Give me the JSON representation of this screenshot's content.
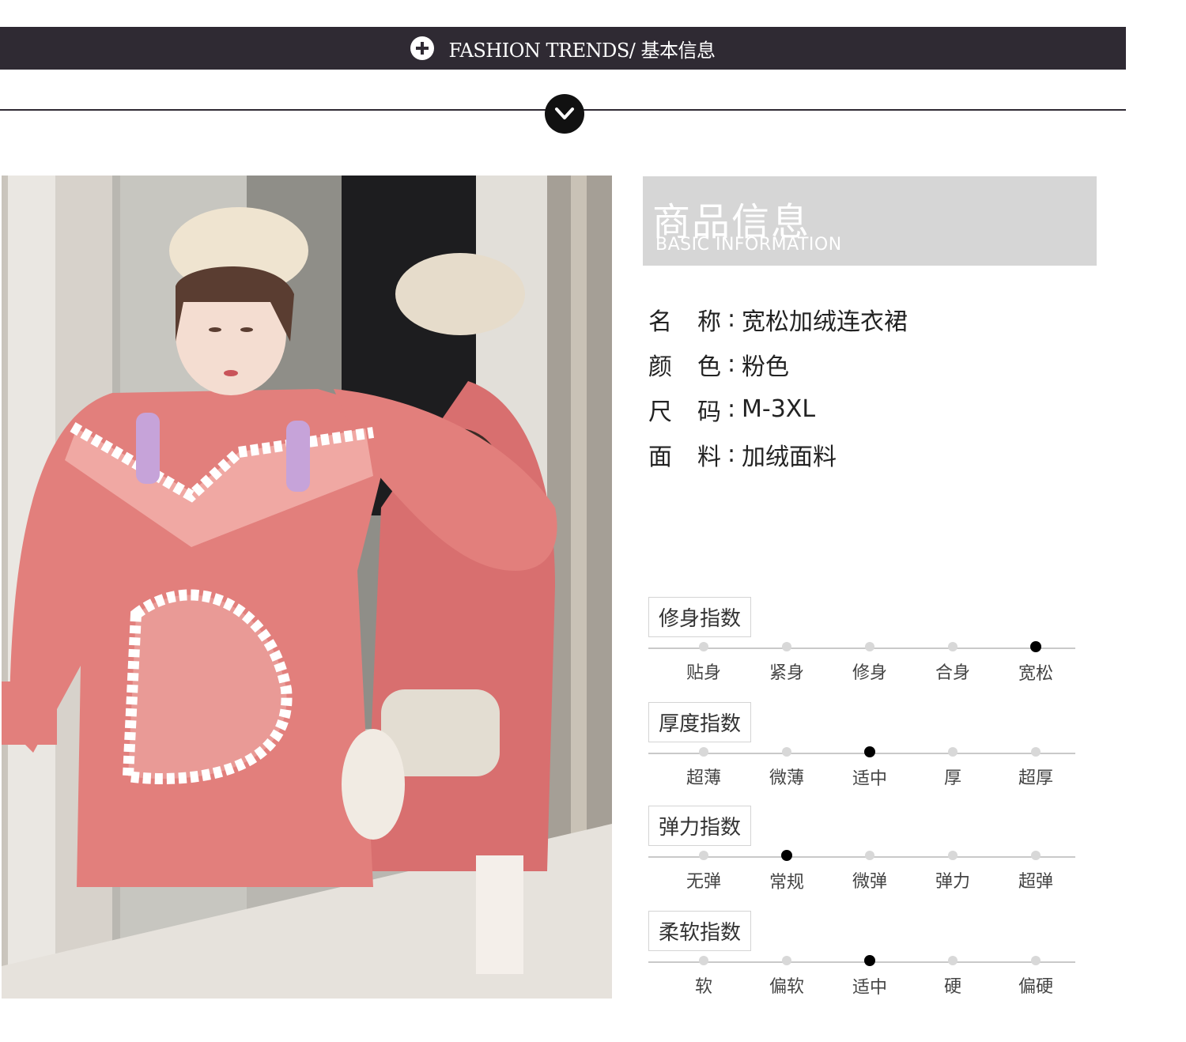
{
  "header": {
    "banner_text": "FASHION TRENDS/  基本信息"
  },
  "info_box": {
    "title_zh": "商品信息",
    "title_en": "BASIC  INFORMATION"
  },
  "attributes": [
    {
      "key": "名称",
      "value": "宽松加绒连衣裙"
    },
    {
      "key": "颜色",
      "value": "粉色"
    },
    {
      "key": "尺码",
      "value": "M-3XL"
    },
    {
      "key": "面料",
      "value": "加绒面料"
    }
  ],
  "indices": [
    {
      "label": "修身指数",
      "options": [
        "贴身",
        "紧身",
        "修身",
        "合身",
        "宽松"
      ],
      "selected": 4
    },
    {
      "label": "厚度指数",
      "options": [
        "超薄",
        "微薄",
        "适中",
        "厚",
        "超厚"
      ],
      "selected": 2
    },
    {
      "label": "弹力指数",
      "options": [
        "无弹",
        "常规",
        "微弹",
        "弹力",
        "超弹"
      ],
      "selected": 1
    },
    {
      "label": "柔软指数",
      "options": [
        "软",
        "偏软",
        "适中",
        "硬",
        "偏硬"
      ],
      "selected": 2
    }
  ],
  "colors": {
    "banner": "#2f2a33",
    "dress": "#e27f7c",
    "beret": "#efe4d0"
  },
  "icons": {
    "banner": "plus-circle-icon",
    "divider": "chevron-down-icon"
  }
}
